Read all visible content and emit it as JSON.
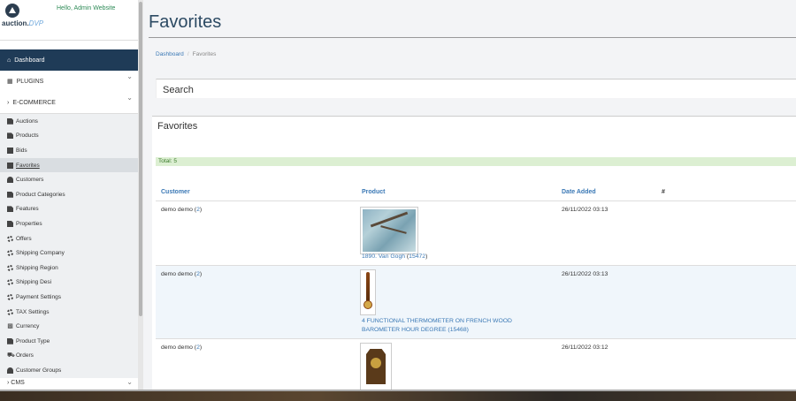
{
  "header": {
    "greeting": "Hello, Admin Website",
    "logo_main": "auction.",
    "logo_accent": "DVP"
  },
  "sidebar": {
    "dashboard": "Dashboard",
    "plugins": "PLUGINS",
    "ecommerce": "E-COMMERCE",
    "items": [
      {
        "label": "Auctions",
        "icon": "document-icon"
      },
      {
        "label": "Products",
        "icon": "document-icon"
      },
      {
        "label": "Bids",
        "icon": "envelope-icon"
      },
      {
        "label": "Favorites",
        "icon": "envelope-icon",
        "active": true
      },
      {
        "label": "Customers",
        "icon": "user-icon"
      },
      {
        "label": "Product Categories",
        "icon": "document-icon"
      },
      {
        "label": "Features",
        "icon": "document-icon"
      },
      {
        "label": "Properties",
        "icon": "document-icon"
      },
      {
        "label": "Offers",
        "icon": "gear-icon"
      },
      {
        "label": "Shipping Company",
        "icon": "gear-icon"
      },
      {
        "label": "Shipping Region",
        "icon": "gear-icon"
      },
      {
        "label": "Shipping Desi",
        "icon": "gear-icon"
      },
      {
        "label": "Payment Settings",
        "icon": "gear-icon"
      },
      {
        "label": "TAX Settings",
        "icon": "gear-icon"
      },
      {
        "label": "Currency",
        "icon": "currency-icon"
      },
      {
        "label": "Product Type",
        "icon": "document-icon"
      },
      {
        "label": "Orders",
        "icon": "cart-icon"
      },
      {
        "label": "Customer Groups",
        "icon": "users-icon"
      }
    ],
    "cms": "CMS"
  },
  "main": {
    "title": "Favorites",
    "breadcrumb": {
      "home": "Dashboard",
      "separator": "/",
      "current": "Favorites"
    },
    "search_label": "Search",
    "panel_title": "Favorites",
    "total": "Total: 5",
    "columns": {
      "customer": "Customer",
      "product": "Product",
      "date": "Date Added",
      "hash": "#"
    },
    "rows": [
      {
        "customer": "demo demo",
        "customer_id": "2",
        "product_line1": "1890. Van Gogh",
        "product_line2": "",
        "product_id": "15472",
        "date": "26/11/2022 03:13"
      },
      {
        "customer": "demo demo",
        "customer_id": "2",
        "product_line1": "4 FUNCTIONAL THERMOMETER ON FRENCH WOOD",
        "product_line2": "BAROMETER HOUR DEGREE",
        "product_id": "15468",
        "date": "26/11/2022 03:13"
      },
      {
        "customer": "demo demo",
        "customer_id": "2",
        "product_line1": "",
        "product_line2": "",
        "product_id": "",
        "date": "26/11/2022 03:12"
      }
    ]
  },
  "colors": {
    "nav_active": "#1f3b57",
    "link": "#3a78b5",
    "total_bg": "#dcefd2",
    "greeting": "#2e8b57"
  }
}
